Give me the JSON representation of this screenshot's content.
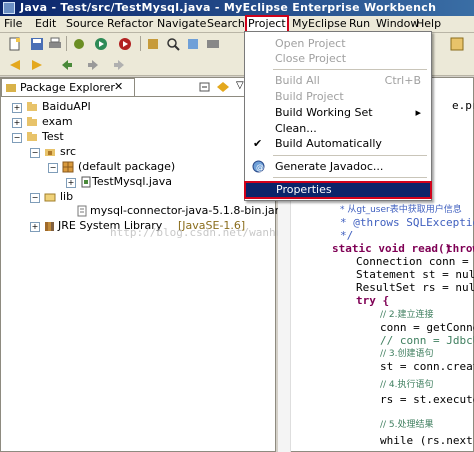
{
  "window": {
    "title": "Java - Test/src/TestMysql.java - MyEclipse Enterprise Workbench"
  },
  "menubar": {
    "items": [
      "File",
      "Edit",
      "Source",
      "Refactor",
      "Navigate",
      "Search",
      "Project",
      "MyEclipse",
      "Run",
      "Window",
      "Help"
    ]
  },
  "package_explorer": {
    "tab_label": "Package Explorer",
    "tree": {
      "baidu": "BaiduAPI",
      "exam": "exam",
      "test": "Test",
      "src": "src",
      "default_package": "(default package)",
      "testmysql": "TestMysql.java",
      "lib": "lib",
      "connector": "mysql-connector-java-5.1.8-bin.jar",
      "jre": "JRE System Library",
      "jre_version": "[JavaSE-1.6]"
    }
  },
  "watermark": "http://blog.csdn.net/wanhui/wei",
  "project_menu": {
    "open_project": "Open Project",
    "close_project": "Close Project",
    "build_all": "Build All",
    "build_all_shortcut": "Ctrl+B",
    "build_project": "Build Project",
    "build_working_set": "Build Working Set",
    "clean": "Clean...",
    "build_automatically": "Build Automatically",
    "generate_javadoc": "Generate Javadoc...",
    "properties": "Properties",
    "submenu_arrow": "▸",
    "check_mark": "✔"
  },
  "editor": {
    "line_top": "e.pr",
    "doc1": "* 从gt_user表中获取用户信息",
    "doc2": "* @throws SQLException",
    "doc3": "*/",
    "sig_kw1": "static void read()",
    "sig_kw2": "throw",
    "l1": "Connection conn = nul",
    "l2": "Statement st = null;",
    "l3": "ResultSet rs = null;",
    "l4": "try {",
    "c1": "// 2.建立连接",
    "l5": "conn = getConnec",
    "c2": "// conn = JdbcUt",
    "c3": "// 3.创建语句",
    "l6": "st = conn.create",
    "c4": "// 4.执行语句",
    "l7": "rs = st.executeQ",
    "c5": "// 5.处理结果",
    "l8": "while (rs.next()"
  },
  "colors": {
    "title_bar": "#0a246a",
    "highlight_border": "#d0021b",
    "selection": "#0a246a",
    "keyword": "#7f0055",
    "comment": "#3f7f5f",
    "javadoc": "#3f5fbf"
  },
  "icons": {
    "toolbar": [
      "new-icon",
      "save-icon",
      "print-icon",
      "debug-icon",
      "run-icon",
      "search-icon",
      "back-icon",
      "forward-icon"
    ]
  }
}
